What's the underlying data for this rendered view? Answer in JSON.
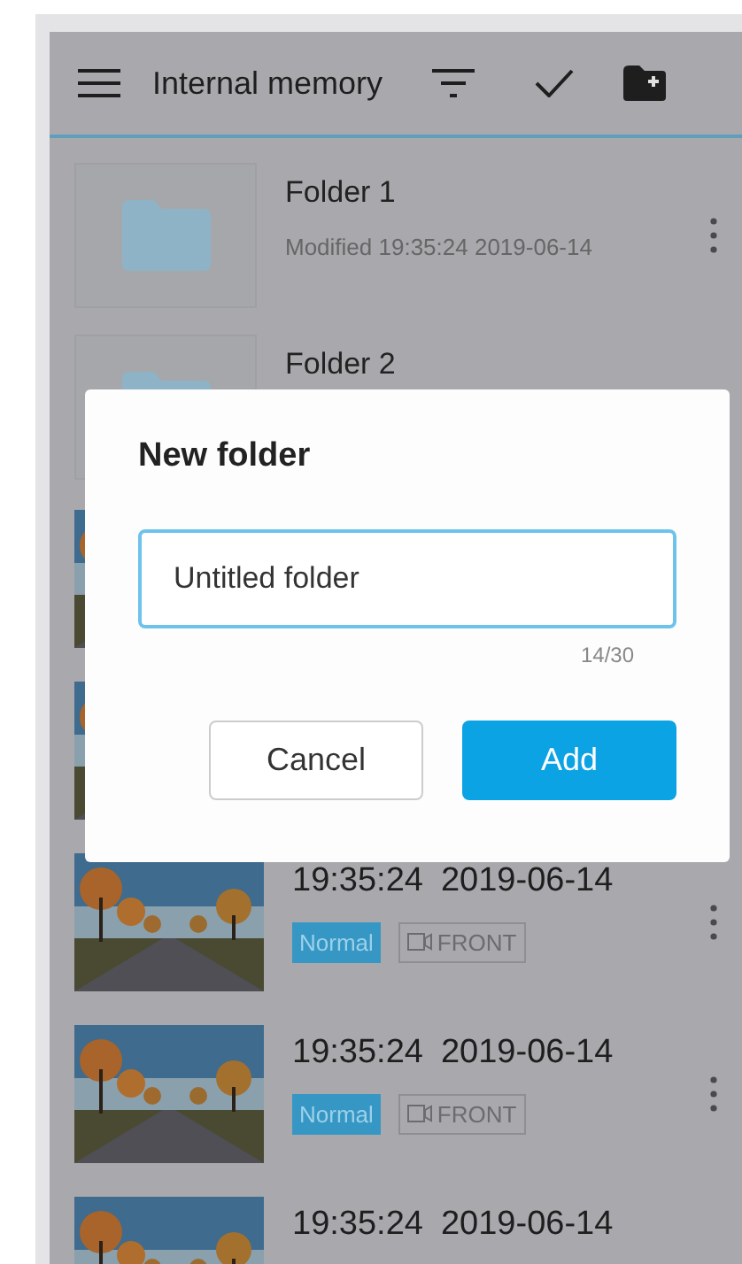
{
  "header": {
    "title": "Internal memory"
  },
  "items": [
    {
      "kind": "folder",
      "name": "Folder 1",
      "modified": "Modified 19:35:24 2019-06-14",
      "menu": true
    },
    {
      "kind": "folder",
      "name": "Folder 2",
      "menu": false
    },
    {
      "kind": "video",
      "menu": false
    },
    {
      "kind": "video",
      "menu": false
    },
    {
      "kind": "video",
      "time": "19:35:24",
      "date": "2019-06-14",
      "tags": [
        "Normal",
        "FRONT"
      ],
      "menu": true
    },
    {
      "kind": "video",
      "time": "19:35:24",
      "date": "2019-06-14",
      "tags": [
        "Normal",
        "FRONT"
      ],
      "menu": true
    },
    {
      "kind": "video",
      "time": "19:35:24",
      "date": "2019-06-14",
      "menu": false
    }
  ],
  "dialog": {
    "title": "New folder",
    "value": "Untitled folder",
    "counter": "14/30",
    "buttons": [
      {
        "label": "Cancel",
        "kind": "secondary"
      },
      {
        "label": "Add",
        "kind": "primary"
      }
    ]
  }
}
